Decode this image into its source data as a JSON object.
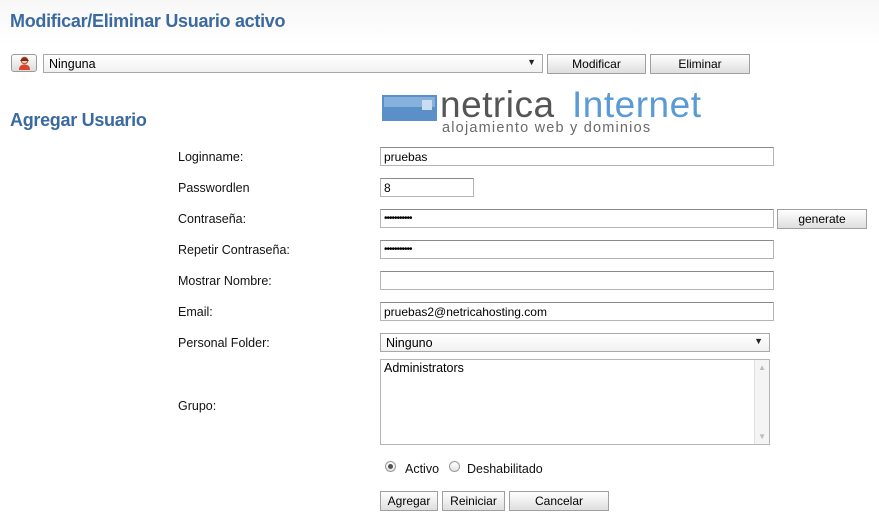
{
  "header": {
    "title": "Modificar/Eliminar Usuario activo"
  },
  "user_select": {
    "value": "Ninguna",
    "modify_label": "Modificar",
    "delete_label": "Eliminar"
  },
  "add_section": {
    "title": "Agregar Usuario"
  },
  "logo": {
    "word1": "netrica",
    "word2": "Internet",
    "tagline": "alojamiento web y dominios"
  },
  "form": {
    "loginname": {
      "label": "Loginname:",
      "value": "pruebas"
    },
    "passwordlen": {
      "label": "Passwordlen",
      "value": "8"
    },
    "password": {
      "label": "Contraseña:",
      "value": "•••••••••••",
      "generate_label": "generate"
    },
    "password_repeat": {
      "label": "Repetir Contraseña:",
      "value": "•••••••••••"
    },
    "display_name": {
      "label": "Mostrar Nombre:",
      "value": ""
    },
    "email": {
      "label": "Email:",
      "value": "pruebas2@netricahosting.com"
    },
    "personal_folder": {
      "label": "Personal Folder:",
      "value": "Ninguno"
    },
    "group": {
      "label": "Grupo:",
      "options": [
        "Administrators"
      ]
    },
    "status": {
      "active_label": "Activo",
      "disabled_label": "Deshabilitado",
      "selected": "Activo"
    }
  },
  "actions": {
    "add_label": "Agregar",
    "reset_label": "Reiniciar",
    "cancel_label": "Cancelar"
  }
}
